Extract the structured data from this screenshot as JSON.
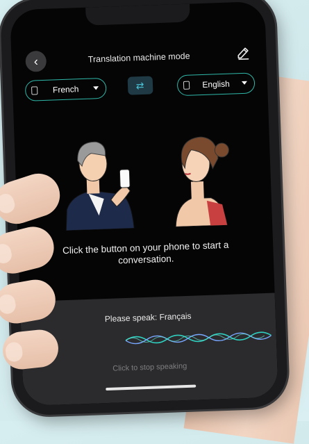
{
  "header": {
    "title": "Translation machine mode",
    "back_icon": "chevron-left-icon",
    "edit_icon": "pencil-icon"
  },
  "languages": {
    "source": "French",
    "target": "English",
    "swap_icon": "swap-arrows-icon",
    "accent_color": "#2fb8a8"
  },
  "main": {
    "instruction": "Click the button on your phone to start a conversation."
  },
  "voice_panel": {
    "prompt": "Please speak: Français",
    "stop_label": "Click to stop speaking",
    "wave_colors": [
      "#2fd0c0",
      "#78a7ff"
    ]
  }
}
